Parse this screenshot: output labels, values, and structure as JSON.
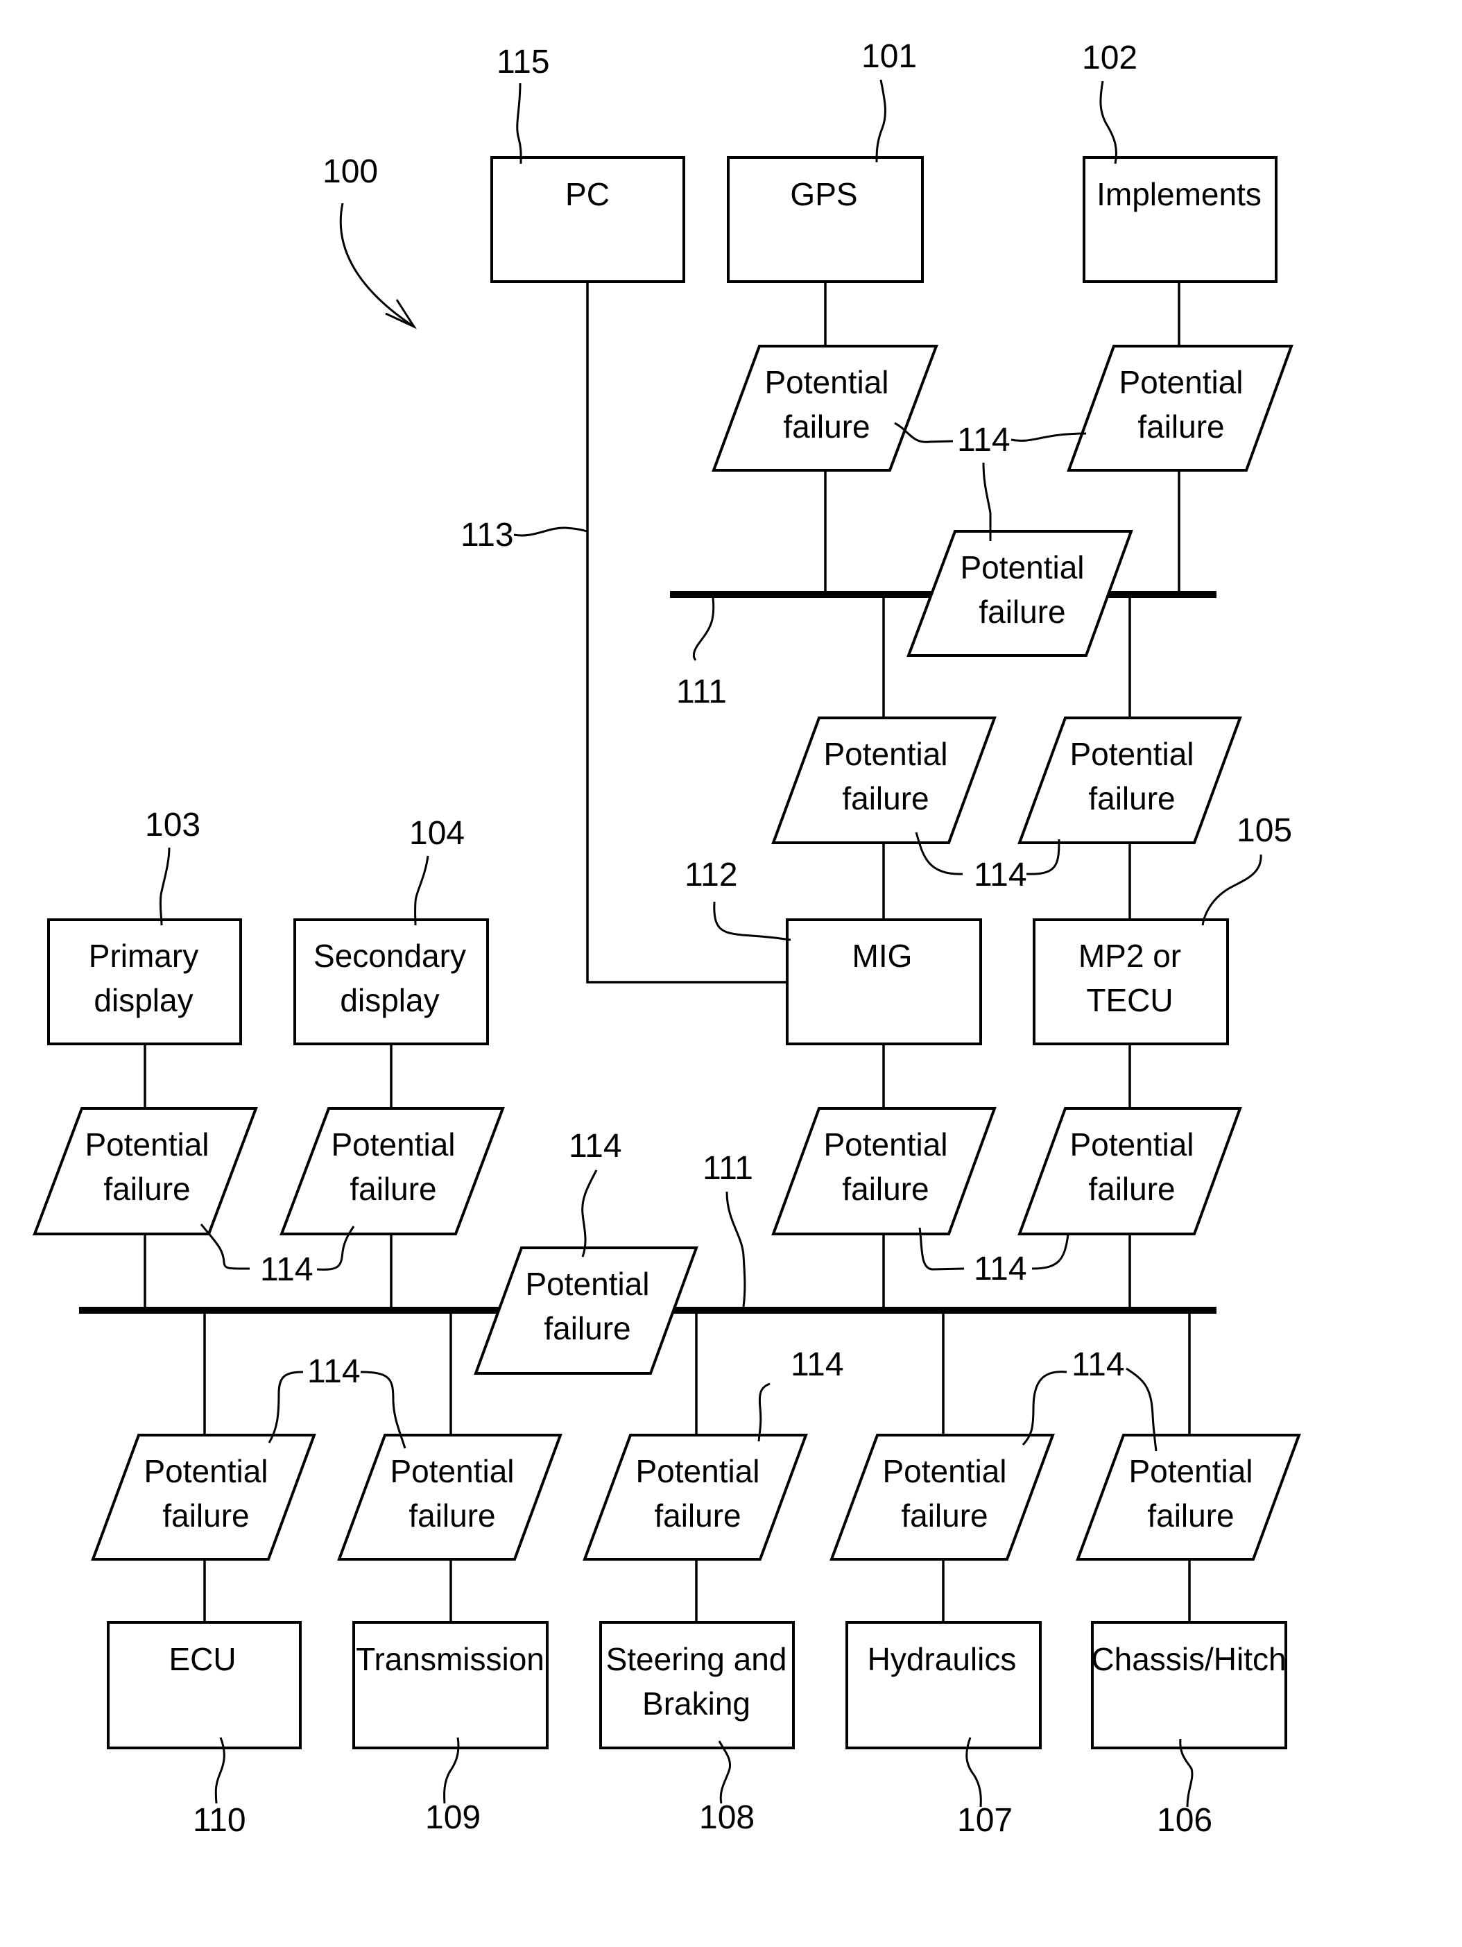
{
  "figure": {
    "system_ref": "100",
    "buses": [
      {
        "id": "upper_bus",
        "ref": "111"
      },
      {
        "id": "lower_bus",
        "ref": "111"
      }
    ],
    "pc_link_ref": "113",
    "failure_ref": "114",
    "nodes": {
      "pc": {
        "lines": [
          "PC"
        ],
        "ref": "115"
      },
      "gps": {
        "lines": [
          "GPS"
        ],
        "ref": "101"
      },
      "implements": {
        "lines": [
          "Implements"
        ],
        "ref": "102"
      },
      "mig": {
        "lines": [
          "MIG"
        ],
        "ref": "112"
      },
      "mp2": {
        "lines": [
          "MP2 or",
          "TECU"
        ],
        "ref": "105"
      },
      "primary": {
        "lines": [
          "Primary",
          "display"
        ],
        "ref": "103"
      },
      "secondary": {
        "lines": [
          "Secondary",
          "display"
        ],
        "ref": "104"
      },
      "ecu": {
        "lines": [
          "ECU"
        ],
        "ref": "110"
      },
      "transmission": {
        "lines": [
          "Transmission"
        ],
        "ref": "109"
      },
      "steering": {
        "lines": [
          "Steering and",
          "Braking"
        ],
        "ref": "108"
      },
      "hydraulics": {
        "lines": [
          "Hydraulics"
        ],
        "ref": "107"
      },
      "chassis": {
        "lines": [
          "Chassis/Hitch"
        ],
        "ref": "106"
      }
    },
    "failure_label": [
      "Potential",
      "failure"
    ]
  }
}
